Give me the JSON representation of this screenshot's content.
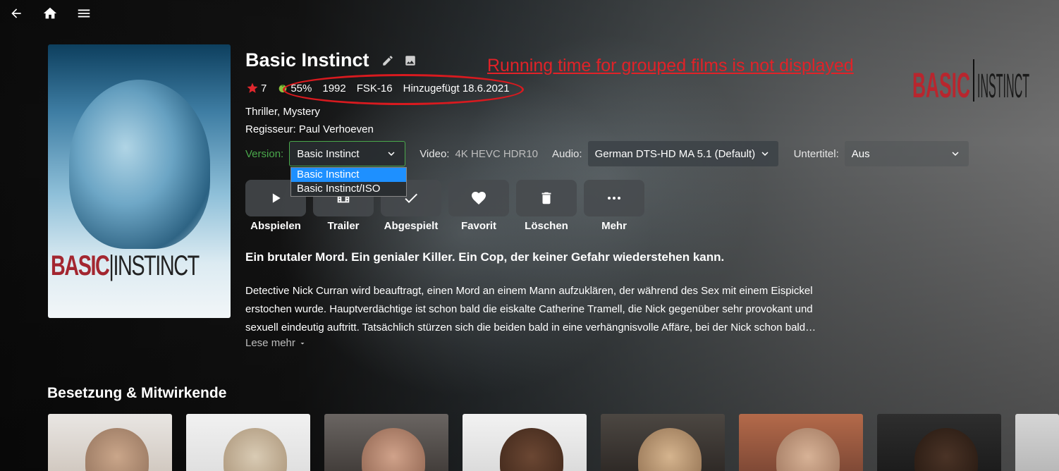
{
  "nav": {
    "back_icon": "arrow-left-icon",
    "home_icon": "home-icon",
    "menu_icon": "hamburger-menu-icon"
  },
  "poster": {
    "title_word1": "BASIC",
    "title_word2": "INSTINCT"
  },
  "logo": {
    "word1": "BASIC",
    "word2": "INSTINCT"
  },
  "movie": {
    "title": "Basic Instinct",
    "rating": "7",
    "critic_score": "55%",
    "year": "1992",
    "certification": "FSK-16",
    "added": "Hinzugefügt 18.6.2021",
    "genres": "Thriller, Mystery",
    "director": "Regisseur: Paul Verhoeven",
    "tagline": "Ein brutaler Mord. Ein genialer Killer. Ein Cop, der keiner Gefahr wiederstehen kann.",
    "overview": "Detective Nick Curran wird beauftragt, einen Mord an einem Mann aufzuklären, der während des Sex mit einem Eispickel erstochen wurde. Hauptverdächtige ist schon bald die eiskalte Catherine Tramell, die Nick gegenüber sehr provokant und sexuell eindeutig auftritt. Tatsächlich stürzen sich die beiden bald in eine verhängnisvolle Affäre, bei der Nick schon bald…",
    "read_more": "Lese mehr"
  },
  "annotation": {
    "text": "Running time for grouped films is not displayed",
    "color": "#e12228"
  },
  "streams": {
    "version_label": "Version:",
    "version_value": "Basic Instinct",
    "version_options": [
      "Basic Instinct",
      "Basic Instinct/ISO"
    ],
    "video_label": "Video:",
    "video_value": "4K HEVC HDR10",
    "audio_label": "Audio:",
    "audio_value": "German DTS-HD MA 5.1 (Default)",
    "subtitle_label": "Untertitel:",
    "subtitle_value": "Aus"
  },
  "actions": [
    {
      "label": "Abspielen",
      "icon": "play-icon"
    },
    {
      "label": "Trailer",
      "icon": "film-icon"
    },
    {
      "label": "Abgespielt",
      "icon": "check-icon"
    },
    {
      "label": "Favorit",
      "icon": "heart-icon"
    },
    {
      "label": "Löschen",
      "icon": "trash-icon"
    },
    {
      "label": "Mehr",
      "icon": "more-dots-icon"
    }
  ],
  "cast": {
    "title": "Besetzung & Mitwirkende"
  },
  "colors": {
    "accent_green": "#4aa84b",
    "dropdown_selected": "#1e90ff",
    "star": "#e0272d"
  }
}
